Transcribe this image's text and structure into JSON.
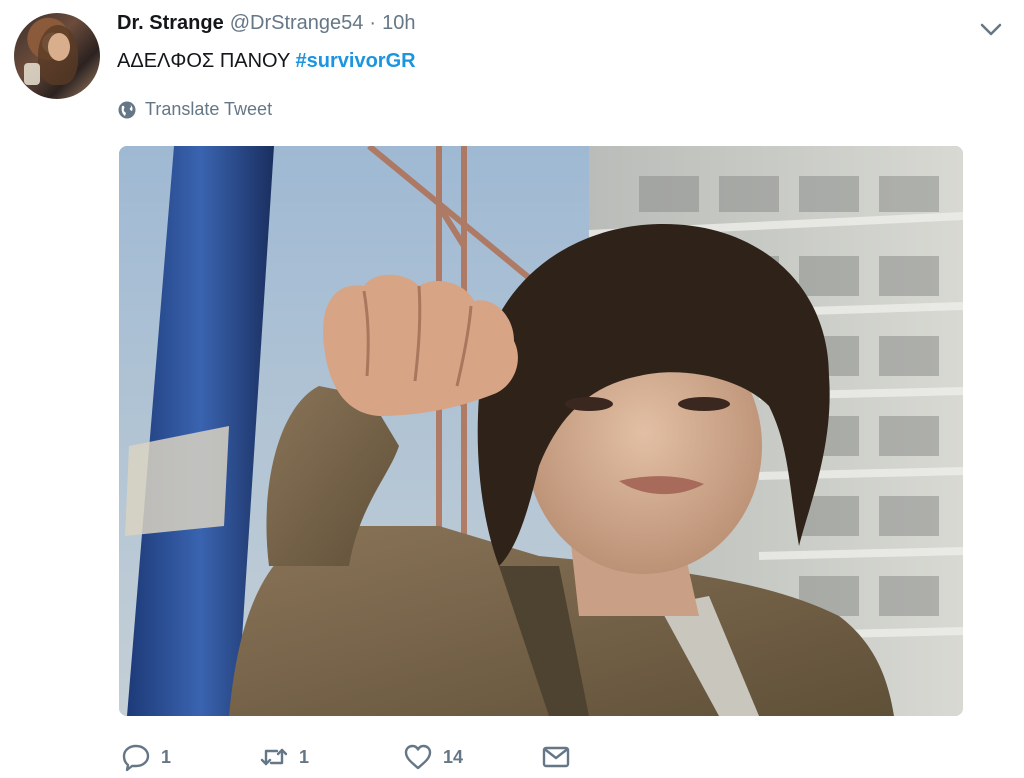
{
  "tweet": {
    "author": {
      "display_name": "Dr. Strange",
      "handle": "@DrStrange54",
      "separator": "·",
      "time": "10h"
    },
    "text": "ΑΔΕΛΦΟΣ ΠΑΝΟΥ",
    "hashtag": "#survivorGR",
    "translate_label": "Translate Tweet",
    "actions": {
      "reply_count": "1",
      "retweet_count": "1",
      "like_count": "14"
    },
    "icons": {
      "caret": "chevron-down-icon",
      "globe": "globe-icon",
      "reply": "reply-icon",
      "retweet": "retweet-icon",
      "like": "heart-icon",
      "dm": "envelope-icon"
    },
    "colors": {
      "text": "#14171a",
      "secondary": "#657786",
      "hashtag": "#1b95e0"
    }
  }
}
